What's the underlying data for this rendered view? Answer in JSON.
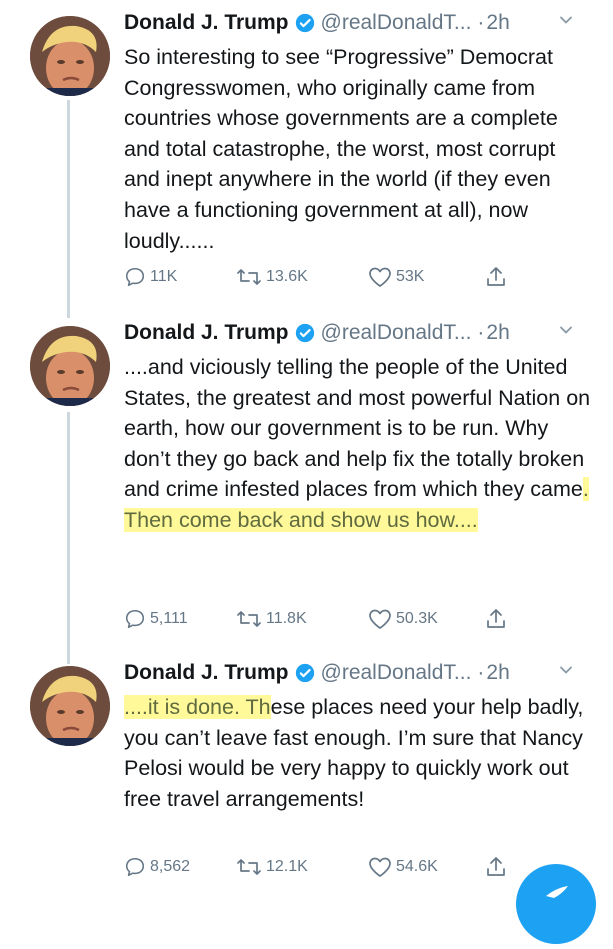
{
  "tweets": [
    {
      "name": "Donald J. Trump",
      "handle": "@realDonaldT...",
      "dot": "·",
      "time": "2h",
      "text": "So interesting to see “Progressive” Democrat Congresswomen, who originally came from countries whose governments are a complete and total catastrophe, the worst, most corrupt and inept anywhere in the world (if they even have a functioning government at all), now loudly......",
      "replies": "11K",
      "retweets": "13.6K",
      "likes": "53K"
    },
    {
      "name": "Donald J. Trump",
      "handle": "@realDonaldT...",
      "dot": "·",
      "time": "2h",
      "text_before": "....and viciously telling the people of the United States, the greatest and most powerful Nation on earth, how our government is to be run. Why don’t they go back and help fix the totally broken and crime infested places from which they came",
      "text_highlight": ". Then come back and show us how....",
      "replies": "5,111",
      "retweets": "11.8K",
      "likes": "50.3K"
    },
    {
      "name": "Donald J. Trump",
      "handle": "@realDonaldT...",
      "dot": "·",
      "time": "2h",
      "text_highlight": "....it is done. Th",
      "text_after": "ese places need your help badly, you can’t leave fast enough. I’m sure that Nancy Pelosi would be very happy to quickly work out free travel arrangements!",
      "replies": "8,562",
      "retweets": "12.1K",
      "likes": "54.6K"
    }
  ],
  "colors": {
    "text": "#14171a",
    "secondary": "#657786",
    "verified": "#1da1f2",
    "highlight": "#fff778",
    "thread_line": "#ccd6dd",
    "fab": "#1da1f2"
  },
  "icons": {
    "verified": "verified-badge-icon",
    "caret": "chevron-down-icon",
    "reply": "reply-icon",
    "retweet": "retweet-icon",
    "like": "heart-icon",
    "share": "share-icon",
    "compose": "compose-tweet-icon"
  }
}
